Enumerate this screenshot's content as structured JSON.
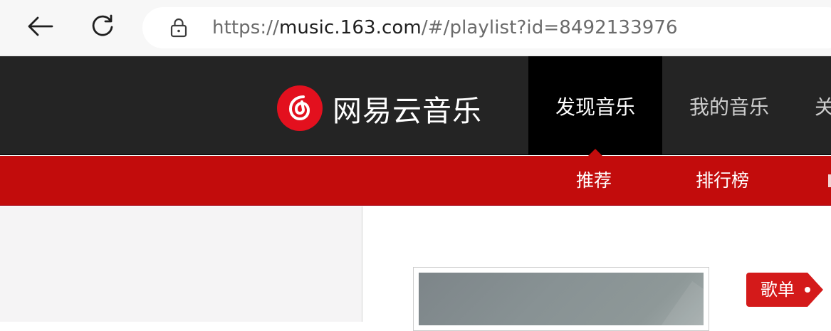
{
  "browser": {
    "url_scheme": "https://",
    "url_host": "music.163.com",
    "url_path": "/#/playlist?id=8492133976"
  },
  "site": {
    "logo_text": "网易云音乐",
    "main_nav": [
      {
        "label": "发现音乐",
        "active": true
      },
      {
        "label": "我的音乐",
        "active": false
      },
      {
        "label": "关",
        "active": false
      }
    ],
    "sub_nav": [
      {
        "label": "推荐"
      },
      {
        "label": "排行榜"
      }
    ]
  },
  "playlist": {
    "tag_label": "歌单"
  },
  "colors": {
    "brand_red": "#c20c0c",
    "topbar": "#242424"
  }
}
